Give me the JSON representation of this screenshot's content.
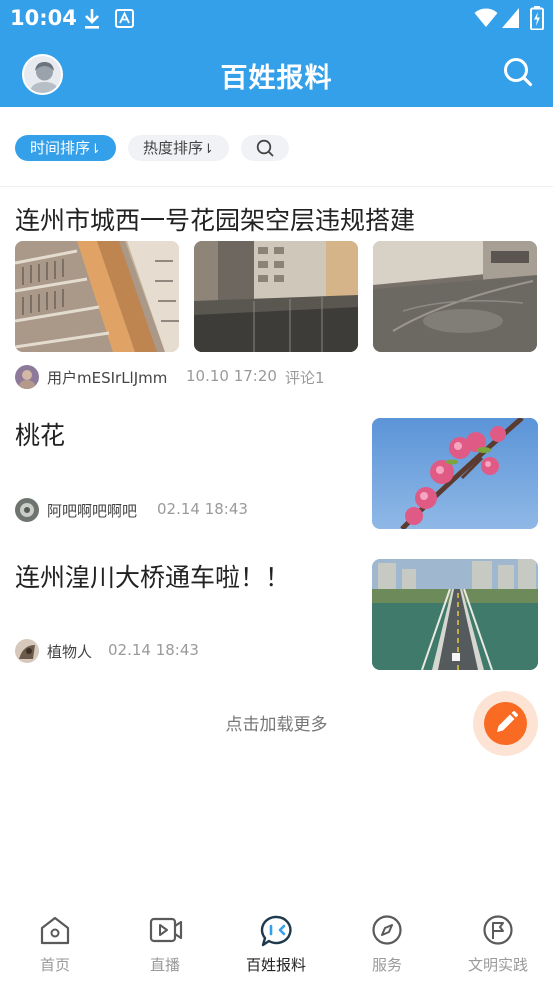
{
  "status_bar": {
    "time": "10:04"
  },
  "header": {
    "title": "百姓报料",
    "icons": [
      "avatar",
      "search-icon"
    ]
  },
  "filters": {
    "time_sort": "时间排序",
    "hot_sort": "热度排序",
    "sort_arrow": "⇂"
  },
  "posts": [
    {
      "title": "连州市城西一号花园架空层违规搭建",
      "user": "用户mESIrLlJmm",
      "time": "10.10 17:20",
      "comments": "评论1"
    },
    {
      "title": "桃花",
      "user": "阿吧啊吧啊吧",
      "time": "02.14 18:43"
    },
    {
      "title": "连州湟川大桥通车啦！！",
      "user": "植物人",
      "time": "02.14 18:43"
    }
  ],
  "load_more": "点击加载更多",
  "bottom_nav": [
    {
      "label": "首页",
      "icon": "home-icon"
    },
    {
      "label": "直播",
      "icon": "live-video-icon"
    },
    {
      "label": "百姓报料",
      "icon": "chat-bubble-icon",
      "active": true
    },
    {
      "label": "服务",
      "icon": "compass-icon"
    },
    {
      "label": "文明实践",
      "icon": "flag-badge-icon"
    }
  ],
  "colors": {
    "primary": "#35a0ea",
    "fab": "#f96a23",
    "fab_halo": "#fde3d4"
  }
}
